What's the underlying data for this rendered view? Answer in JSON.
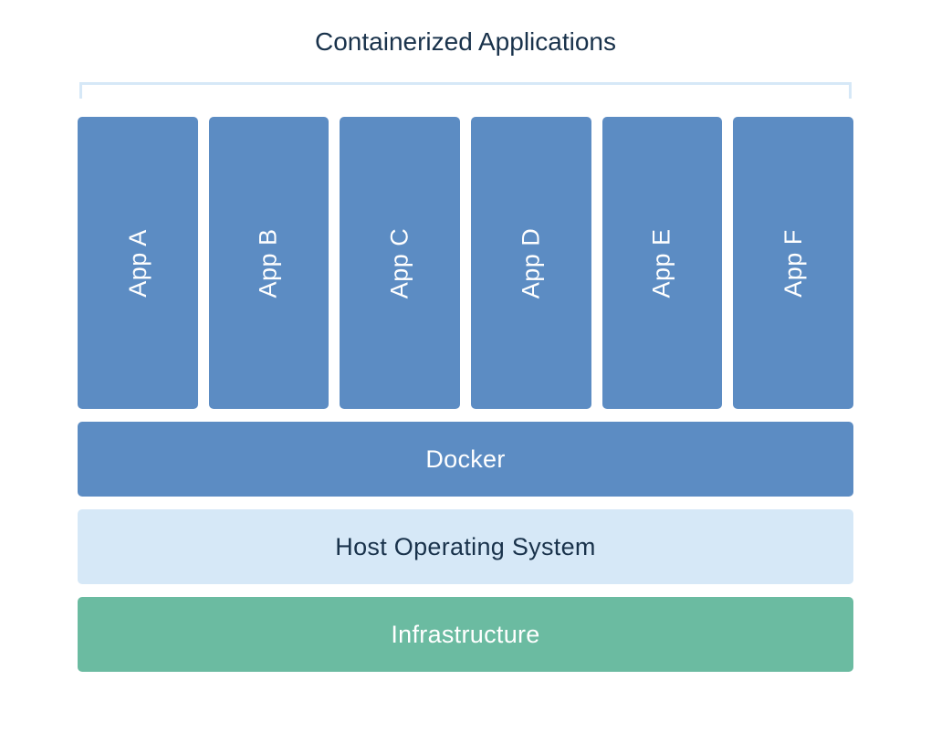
{
  "title": "Containerized Applications",
  "apps": [
    {
      "label": "App A"
    },
    {
      "label": "App B"
    },
    {
      "label": "App C"
    },
    {
      "label": "App D"
    },
    {
      "label": "App E"
    },
    {
      "label": "App F"
    }
  ],
  "layers": {
    "docker": "Docker",
    "host": "Host Operating System",
    "infrastructure": "Infrastructure"
  },
  "colors": {
    "app_box": "#5c8cc3",
    "docker_layer": "#5c8cc3",
    "host_layer": "#d6e8f7",
    "infra_layer": "#6bbba1",
    "text_dark": "#19324b",
    "text_light": "#ffffff",
    "bracket": "#d6e8f7"
  }
}
